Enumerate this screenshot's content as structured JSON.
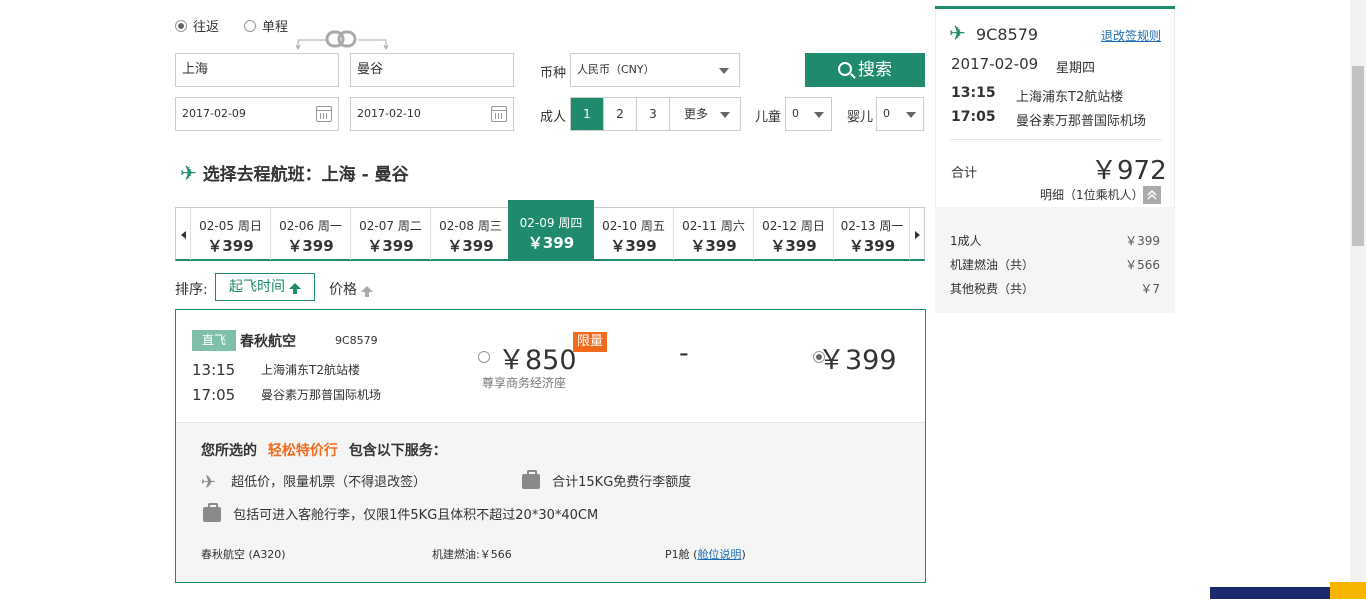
{
  "trip_type": {
    "roundtrip": "往返",
    "oneway": "单程",
    "selected": "roundtrip"
  },
  "search": {
    "from": "上海",
    "to": "曼谷",
    "depart_date": "2017-02-09",
    "return_date": "2017-02-10",
    "currency_label": "币种",
    "currency_value": "人民币（CNY）",
    "adult_label": "成人",
    "adult_options": [
      "1",
      "2",
      "3",
      "更多"
    ],
    "adult_selected": "1",
    "child_label": "儿童",
    "child_value": "0",
    "infant_label": "婴儿",
    "infant_value": "0",
    "search_button": "搜索"
  },
  "section_title": "选择去程航班：上海 - 曼谷",
  "dates": [
    {
      "date": "02-05",
      "weekday": "周日",
      "price": "￥399"
    },
    {
      "date": "02-06",
      "weekday": "周一",
      "price": "￥399"
    },
    {
      "date": "02-07",
      "weekday": "周二",
      "price": "￥399"
    },
    {
      "date": "02-08",
      "weekday": "周三",
      "price": "￥399"
    },
    {
      "date": "02-09",
      "weekday": "周四",
      "price": "￥399",
      "selected": true
    },
    {
      "date": "02-10",
      "weekday": "周五",
      "price": "￥399"
    },
    {
      "date": "02-11",
      "weekday": "周六",
      "price": "￥399"
    },
    {
      "date": "02-12",
      "weekday": "周日",
      "price": "￥399"
    },
    {
      "date": "02-13",
      "weekday": "周一",
      "price": "￥399"
    }
  ],
  "sort": {
    "label": "排序:",
    "by_time": "起飞时间",
    "by_price": "价格"
  },
  "flight": {
    "direct_badge": "直飞",
    "airline": "春秋航空",
    "flight_no": "9C8579",
    "depart_time": "13:15",
    "depart_airport": "上海浦东T2航站楼",
    "arrive_time": "17:05",
    "arrive_airport": "曼谷素万那普国际机场",
    "fare1_price": "￥850",
    "fare1_badge": "限量",
    "fare1_sub": "尊享商务经济座",
    "fare2_price": "-",
    "fare3_price": "￥399",
    "services_prefix": "您所选的",
    "services_highlight": "轻松特价行",
    "services_suffix": "包含以下服务：",
    "service_1": "超低价，限量机票（不得退改签）",
    "service_2": "合计15KG免费行李额度",
    "service_3": "包括可进入客舱行李，仅限1件5KG且体积不超过20*30*40CM",
    "aircraft": "春秋航空 (A320)",
    "fuel_tax": "机建燃油:￥566",
    "cabin": "P1舱",
    "cabin_link": "舱位说明",
    "cabin_paren_open": "(",
    "cabin_paren_close": ")"
  },
  "summary": {
    "flight_no": "9C8579",
    "rules_link": "退改签规则",
    "date": "2017-02-09",
    "weekday": "星期四",
    "depart_time": "13:15",
    "depart_airport": "上海浦东T2航站楼",
    "arrive_time": "17:05",
    "arrive_airport": "曼谷素万那普国际机场",
    "total_label": "合计",
    "total_price": "￥972",
    "detail_label": "明细（1位乘机人）",
    "items": [
      {
        "label": "1成人",
        "value": "￥399"
      },
      {
        "label": "机建燃油（共）",
        "value": "￥566"
      },
      {
        "label": "其他税费（共）",
        "value": "￥7"
      }
    ]
  },
  "colors": {
    "accent": "#1f8a6d",
    "highlight": "#f26b1d",
    "link": "#1f6fb5"
  }
}
